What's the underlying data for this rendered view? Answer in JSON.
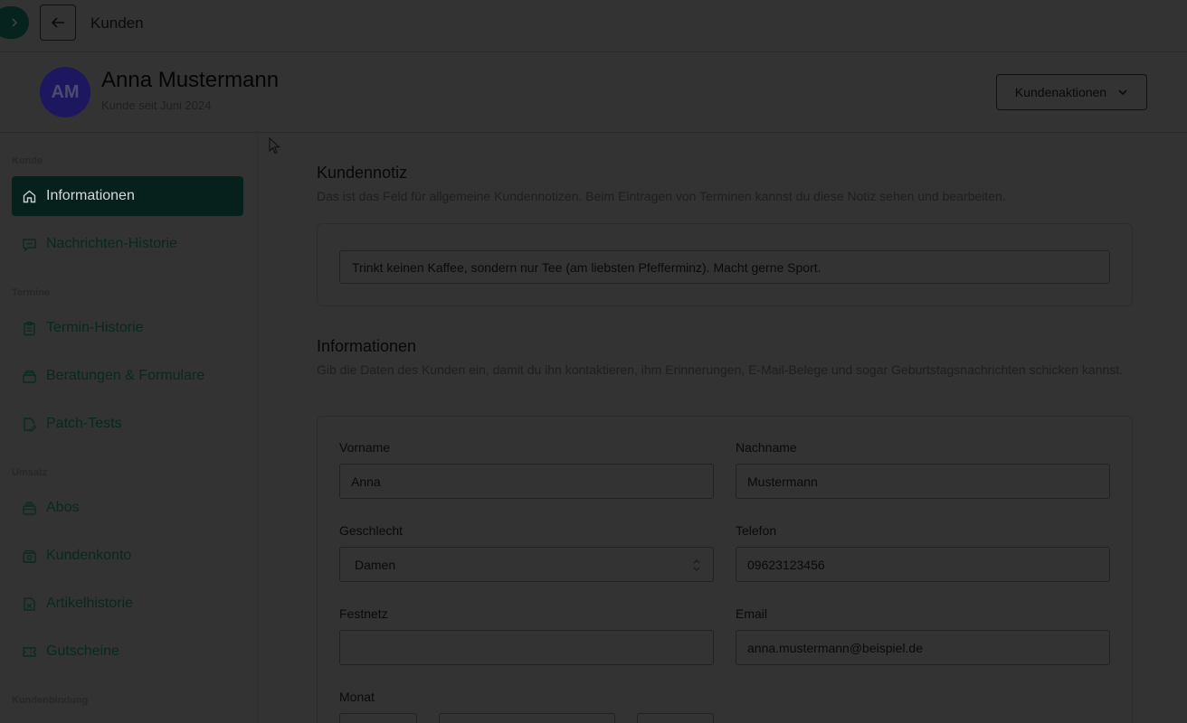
{
  "topbar": {
    "breadcrumb": "Kunden"
  },
  "customer": {
    "initials": "AM",
    "name": "Anna Mustermann",
    "since": "Kunde seit Juni 2024"
  },
  "header": {
    "actions_label": "Kundenaktionen"
  },
  "sidebar": {
    "sections": {
      "kunde": "Kunde",
      "termine": "Termine",
      "umsatz": "Umsatz",
      "kundenbindung": "Kundenbindung"
    },
    "items": {
      "informationen": "Informationen",
      "nachrichten": "Nachrichten-Historie",
      "termin_historie": "Termin-Historie",
      "beratungen": "Beratungen & Formulare",
      "patch_tests": "Patch-Tests",
      "abos": "Abos",
      "kundenkonto": "Kundenkonto",
      "artikelhistorie": "Artikelhistorie",
      "gutscheine": "Gutscheine"
    }
  },
  "note": {
    "title": "Kundennotiz",
    "description": "Das ist das Feld für allgemeine Kundennotizen. Beim Eintragen von Terminen kannst du diese Notiz sehen und bearbeiten.",
    "value": "Trinkt keinen Kaffee, sondern nur Tee (am liebsten Pfefferminz). Macht gerne Sport."
  },
  "info": {
    "title": "Informationen",
    "description": "Gib die Daten des Kunden ein, damit du ihn kontaktieren, ihm Erinnerungen, E-Mail-Belege und sogar Geburtstagsnachrichten schicken kannst.",
    "fields": {
      "vorname": {
        "label": "Vorname",
        "value": "Anna"
      },
      "nachname": {
        "label": "Nachname",
        "value": "Mustermann"
      },
      "geschlecht": {
        "label": "Geschlecht",
        "value": "Damen"
      },
      "telefon": {
        "label": "Telefon",
        "value": "09623123456"
      },
      "festnetz": {
        "label": "Festnetz",
        "value": ""
      },
      "email": {
        "label": "Email",
        "value": "anna.mustermann@beispiel.de"
      },
      "monat": {
        "label": "Monat"
      }
    }
  },
  "colors": {
    "overlay_bg": "#333333",
    "accent_dark": "#06201b",
    "avatar_bg": "#1d1760"
  }
}
